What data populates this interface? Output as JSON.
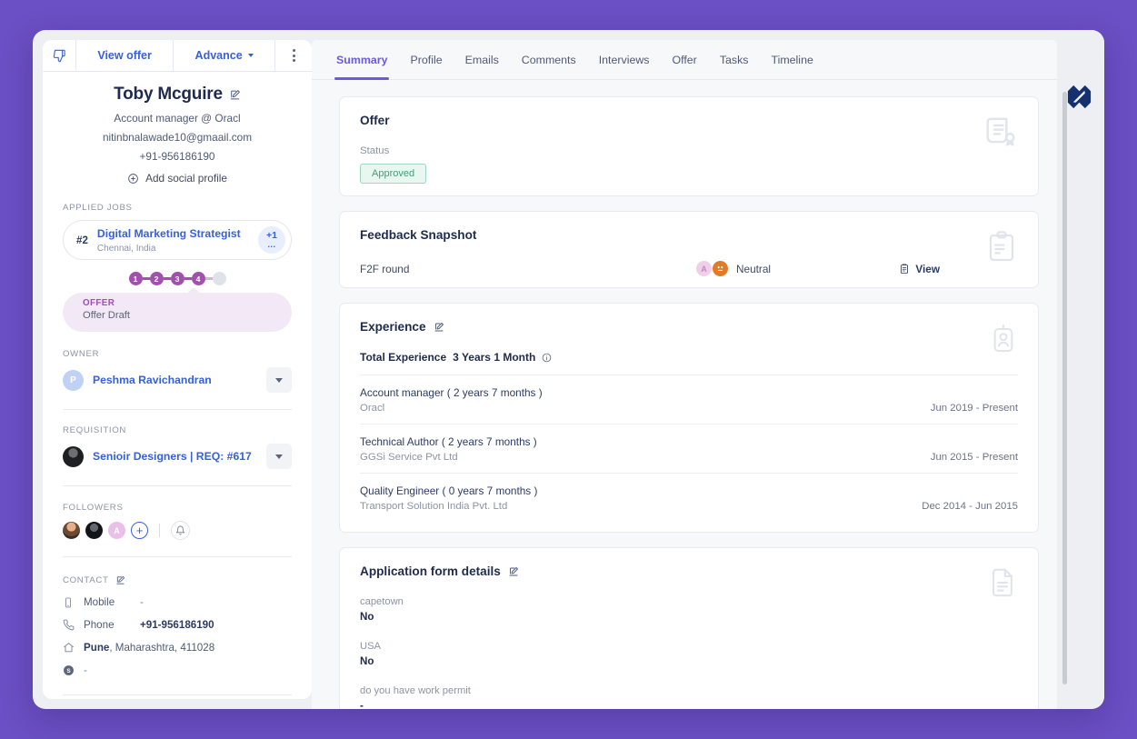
{
  "theme": {
    "page_bg": "#6b4fc4",
    "accent": "#6a5ae0",
    "link": "#3761d6",
    "stage": "#a34fb0"
  },
  "sidebar": {
    "toolbar": {
      "reject_icon": "thumbs-down-icon",
      "view_offer_label": "View offer",
      "advance_label": "Advance",
      "more_icon": "kebab-menu-icon"
    },
    "candidate": {
      "name": "Toby Mcguire",
      "edit_icon": "edit-icon",
      "headline": "Account manager @ Oracl",
      "email": "nitinbnalawade10@gmaail.com",
      "phone": "+91-956186190",
      "add_social_label": "Add social profile",
      "add_social_icon": "plus-circle-icon"
    },
    "applied_jobs": {
      "label": "APPLIED JOBS",
      "job": {
        "number": "#2",
        "title": "Digital Marketing Strategist",
        "location": "Chennai, India",
        "more_count": "+1",
        "more_ellipsis": "..."
      }
    },
    "stages": {
      "steps": [
        "1",
        "2",
        "3",
        "4"
      ],
      "current_index": 4,
      "empty_step": true,
      "pill_kind": "OFFER",
      "pill_value": "Offer Draft"
    },
    "owner": {
      "label": "OWNER",
      "avatar_initial": "P",
      "name": "Peshma Ravichandran",
      "chevron_icon": "chevron-down-icon"
    },
    "requisition": {
      "label": "REQUISITION",
      "name": "Senioir Designers | REQ: #617",
      "chevron_icon": "chevron-down-icon"
    },
    "followers": {
      "label": "FOLLOWERS",
      "avatars": [
        "",
        "",
        "A"
      ],
      "add_icon": "plus-circle-icon",
      "bell_icon": "bell-icon"
    },
    "contact": {
      "label": "CONTACT",
      "edit_icon": "edit-icon",
      "rows": [
        {
          "icon": "mobile-icon",
          "key": "Mobile",
          "value": "-"
        },
        {
          "icon": "phone-icon",
          "key": "Phone",
          "value": "+91-956186190"
        },
        {
          "icon": "home-icon",
          "key": "",
          "value": "Pune, Maharashtra, 411028",
          "city": "Pune",
          "rest": ", Maharashtra, 411028"
        },
        {
          "icon": "skype-icon",
          "key": "",
          "value": "-"
        }
      ]
    }
  },
  "main": {
    "tabs": [
      {
        "label": "Summary",
        "active": true
      },
      {
        "label": "Profile",
        "active": false
      },
      {
        "label": "Emails",
        "active": false
      },
      {
        "label": "Comments",
        "active": false
      },
      {
        "label": "Interviews",
        "active": false
      },
      {
        "label": "Offer",
        "active": false
      },
      {
        "label": "Tasks",
        "active": false
      },
      {
        "label": "Timeline",
        "active": false
      }
    ],
    "offer_card": {
      "title": "Offer",
      "status_label": "Status",
      "status_value": "Approved",
      "bg_icon": "certificate-icon"
    },
    "feedback_card": {
      "title": "Feedback Snapshot",
      "round": "F2F round",
      "avatar_initial": "A",
      "rating": "Neutral",
      "view_label": "View",
      "view_icon": "clipboard-icon",
      "bg_icon": "clipboard-check-icon"
    },
    "experience_card": {
      "title": "Experience",
      "edit_icon": "edit-icon",
      "total_label": "Total Experience",
      "total_value": "3 Years 1 Month",
      "info_icon": "info-icon",
      "bg_icon": "id-badge-icon",
      "items": [
        {
          "role": "Account manager ( 2 years 7 months )",
          "company": "Oracl",
          "dates": "Jun 2019 - Present"
        },
        {
          "role": "Technical Author ( 2 years 7 months )",
          "company": "GGSi Service Pvt Ltd",
          "dates": "Jun 2015 - Present"
        },
        {
          "role": "Quality Engineer ( 0 years 7 months )",
          "company": "Transport Solution India Pvt. Ltd",
          "dates": "Dec 2014 - Jun 2015"
        }
      ]
    },
    "application_form_card": {
      "title": "Application form details",
      "edit_icon": "edit-icon",
      "bg_icon": "document-icon",
      "fields": [
        {
          "question": "capetown",
          "answer": "No"
        },
        {
          "question": "USA",
          "answer": "No"
        },
        {
          "question": "do you have work permit",
          "answer": "-"
        }
      ]
    },
    "logo_icon": "app-logo-icon",
    "scrollbar": "vertical-scrollbar"
  }
}
